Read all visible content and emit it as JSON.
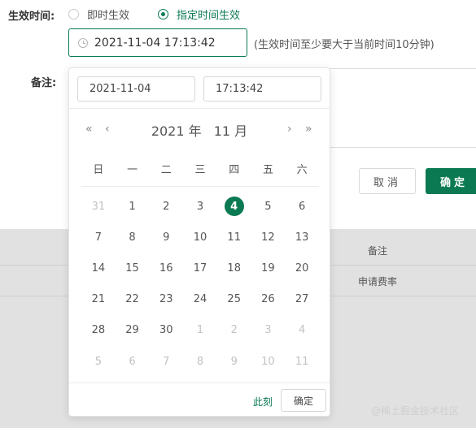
{
  "form": {
    "effective_label": "生效时间:",
    "radio_now_label": "即时生效",
    "radio_specified_label": "指定时间生效",
    "datetime_value": "2021-11-04 17:13:42",
    "hint": "(生效时间至少要大于当前时间10分钟)",
    "remark_label": "备注:",
    "cancel_label": "取消",
    "ok_label": "确定"
  },
  "background_table": {
    "header_remark": "备注",
    "cell_remark": "申请费率"
  },
  "picker": {
    "date_input": "2021-11-04",
    "time_input": "17:13:42",
    "nav_prev_year": "«",
    "nav_prev_month": "‹",
    "nav_next_month": "›",
    "nav_next_year": "»",
    "year": "2021 年",
    "month": "11 月",
    "weekdays": [
      "日",
      "一",
      "二",
      "三",
      "四",
      "五",
      "六"
    ],
    "days": [
      {
        "d": "31",
        "other": true
      },
      {
        "d": "1"
      },
      {
        "d": "2"
      },
      {
        "d": "3"
      },
      {
        "d": "4",
        "selected": true
      },
      {
        "d": "5"
      },
      {
        "d": "6"
      },
      {
        "d": "7"
      },
      {
        "d": "8"
      },
      {
        "d": "9"
      },
      {
        "d": "10"
      },
      {
        "d": "11"
      },
      {
        "d": "12"
      },
      {
        "d": "13"
      },
      {
        "d": "14"
      },
      {
        "d": "15"
      },
      {
        "d": "16"
      },
      {
        "d": "17"
      },
      {
        "d": "18"
      },
      {
        "d": "19"
      },
      {
        "d": "20"
      },
      {
        "d": "21"
      },
      {
        "d": "22"
      },
      {
        "d": "23"
      },
      {
        "d": "24"
      },
      {
        "d": "25"
      },
      {
        "d": "26"
      },
      {
        "d": "27"
      },
      {
        "d": "28"
      },
      {
        "d": "29"
      },
      {
        "d": "30"
      },
      {
        "d": "1",
        "other": true
      },
      {
        "d": "2",
        "other": true
      },
      {
        "d": "3",
        "other": true
      },
      {
        "d": "4",
        "other": true
      },
      {
        "d": "5",
        "other": true
      },
      {
        "d": "6",
        "other": true
      },
      {
        "d": "7",
        "other": true
      },
      {
        "d": "8",
        "other": true
      },
      {
        "d": "9",
        "other": true
      },
      {
        "d": "10",
        "other": true
      },
      {
        "d": "11",
        "other": true
      }
    ],
    "now_label": "此刻",
    "ok_label": "确定"
  },
  "watermark": "@稀土掘金技术社区",
  "colors": {
    "accent": "#0b7a52",
    "overlay": "#e1e1e1"
  }
}
